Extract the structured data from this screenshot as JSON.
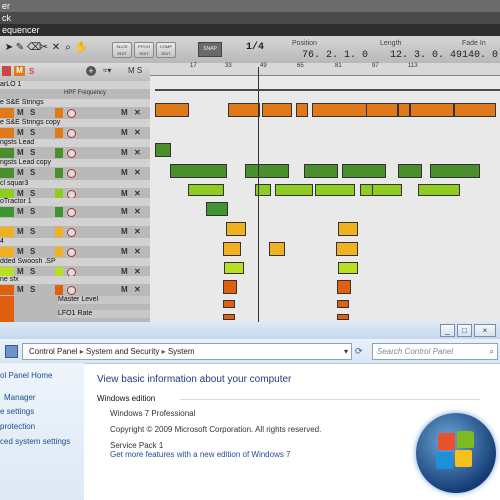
{
  "daw": {
    "title_fragments": [
      "er",
      "ck",
      "equencer"
    ],
    "toolbar": {
      "slice_edit": "SLICE EDIT",
      "pitch_edit": "PITCH EDIT",
      "comp_edit": "COMP EDIT",
      "snap": "SNAP",
      "quantize": "1/4",
      "position_label": "Position",
      "position_value": "76. 2. 1.  0",
      "length_label": "Length",
      "length_value": "12. 3. 0. 49",
      "fade_label": "Fade In",
      "fade_value": "140.  0"
    },
    "ruler_ticks": [
      "17",
      "33",
      "49",
      "65",
      "81",
      "97",
      "113"
    ],
    "tracks": [
      {
        "name": "arLO 1",
        "sub": "HPF Frequency",
        "color": "#b06018"
      },
      {
        "name": "e S&E Strings",
        "color": "#e07a18"
      },
      {
        "name": "e S&E Strings copy",
        "color": "#e07a18"
      },
      {
        "name": "ngsts Lead",
        "color": "#4b8f2c"
      },
      {
        "name": "ngsts Lead copy",
        "color": "#4b8f2c"
      },
      {
        "name": "cl squar3",
        "color": "#8ecc22"
      },
      {
        "name": "oTractor 1",
        "color": "#3f9630"
      },
      {
        "name": "",
        "color": "#f0b020"
      },
      {
        "name": "4",
        "color": "#f0b020"
      },
      {
        "name": "dded Swoosh .SP",
        "color": "#b8e020"
      },
      {
        "name": "ne sfx",
        "color": "#e06010"
      },
      {
        "name": "Master Level",
        "color": "#e06010"
      },
      {
        "name": "LFO1 Rate",
        "color": "#e06010"
      }
    ]
  },
  "window": {
    "buttons": [
      "_",
      "□",
      "×"
    ],
    "breadcrumb": [
      "Control Panel",
      "System and Security",
      "System"
    ],
    "search_placeholder": "Search Control Panel",
    "sidebar": [
      "ol Panel Home",
      "Manager",
      "e settings",
      "protection",
      "ced system settings"
    ],
    "heading": "View basic information about your computer",
    "edition_label": "Windows edition",
    "edition": "Windows 7 Professional",
    "copyright": "Copyright © 2009 Microsoft Corporation.  All rights reserved.",
    "service_pack": "Service Pack 1",
    "more_features": "Get more features with a new edition of Windows 7"
  }
}
